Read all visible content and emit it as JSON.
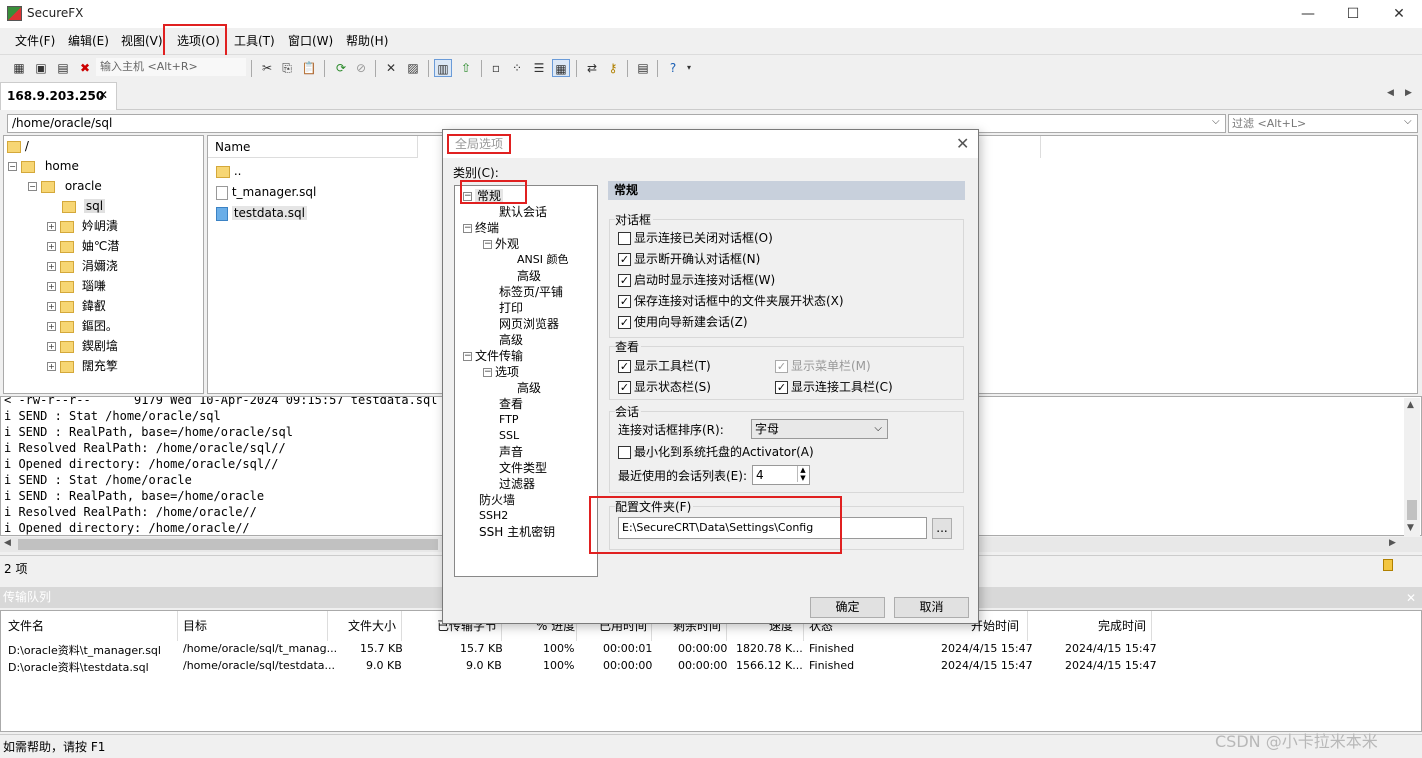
{
  "window": {
    "title": "SecureFX",
    "minimize": "—",
    "maximize": "☐",
    "close": "✕"
  },
  "menu": [
    "文件(F)",
    "编辑(E)",
    "视图(V)",
    "选项(O)",
    "工具(T)",
    "窗口(W)",
    "帮助(H)"
  ],
  "toolbar": {
    "host_placeholder": "输入主机 <Alt+R>"
  },
  "tab": {
    "label": "168.9.203.250",
    "close": "✕",
    "nav_left": "◀",
    "nav_right": "▶"
  },
  "path": {
    "value": "/home/oracle/sql",
    "filter_placeholder": "过滤 <Alt+L>"
  },
  "tree": [
    {
      "label": "/",
      "level": 0,
      "expander": ""
    },
    {
      "label": "home",
      "level": 1,
      "expander": "−"
    },
    {
      "label": "oracle",
      "level": 2,
      "expander": "−"
    },
    {
      "label": "sql",
      "level": 3,
      "expander": ""
    },
    {
      "label": "妗岄潰",
      "level": 3,
      "expander": "+"
    },
    {
      "label": "妯℃澘",
      "level": 3,
      "expander": "+"
    },
    {
      "label": "涓嬭浇",
      "level": 3,
      "expander": "+"
    },
    {
      "label": "瑙嗛",
      "level": 3,
      "expander": "+"
    },
    {
      "label": "鍏叡",
      "level": 3,
      "expander": "+"
    },
    {
      "label": "鏂囨。",
      "level": 3,
      "expander": "+"
    },
    {
      "label": "鍥剧墖",
      "level": 3,
      "expander": "+"
    },
    {
      "label": "闊充箰",
      "level": 3,
      "expander": "+"
    }
  ],
  "files": {
    "header": "Name",
    "items": [
      {
        "name": "..",
        "type": "folder"
      },
      {
        "name": "t_manager.sql",
        "type": "file"
      },
      {
        "name": "testdata.sql",
        "type": "file-selected"
      }
    ]
  },
  "log": [
    "< -rw-r--r--      9179 Wed 10-Apr-2024 09:15:57 testdata.sql",
    "i SEND : Stat /home/oracle/sql",
    "i SEND : RealPath, base=/home/oracle/sql",
    "i Resolved RealPath: /home/oracle/sql//",
    "i Opened directory: /home/oracle/sql//",
    "i SEND : Stat /home/oracle",
    "i SEND : RealPath, base=/home/oracle",
    "i Resolved RealPath: /home/oracle//",
    "i Opened directory: /home/oracle//"
  ],
  "status": {
    "items_count": "2 项",
    "help": "如需帮助，请按 F1"
  },
  "queue": {
    "title": "传输队列",
    "close": "✕",
    "columns": [
      "文件名",
      "目标",
      "文件大小",
      "已传输字节",
      "% 进度",
      "已用时间",
      "剩余时间",
      "速度",
      "状态",
      "开始时间",
      "完成时间"
    ],
    "rows": [
      [
        "D:\\oracle资料\\t_manager.sql",
        "/home/oracle/sql/t_manag...",
        "15.7 KB",
        "15.7 KB",
        "100%",
        "00:00:01",
        "00:00:00",
        "1820.78 K...",
        "Finished",
        "2024/4/15 15:47",
        "2024/4/15 15:47"
      ],
      [
        "D:\\oracle资料\\testdata.sql",
        "/home/oracle/sql/testdata...",
        "9.0 KB",
        "9.0 KB",
        "100%",
        "00:00:00",
        "00:00:00",
        "1566.12 K...",
        "Finished",
        "2024/4/15 15:47",
        "2024/4/15 15:47"
      ]
    ]
  },
  "dialog": {
    "title": "全局选项",
    "close": "✕",
    "category_label": "类别(C):",
    "categories": [
      {
        "label": "常规",
        "expander": "−",
        "small": false
      },
      {
        "label": "默认会话",
        "expander": "",
        "small": false
      },
      {
        "label": "终端",
        "expander": "−",
        "small": false
      },
      {
        "label": "外观",
        "expander": "−",
        "small": false
      },
      {
        "label": "ANSI 颜色",
        "expander": "",
        "small": true
      },
      {
        "label": "高级",
        "expander": "",
        "small": false
      },
      {
        "label": "标签页/平铺",
        "expander": "",
        "small": false
      },
      {
        "label": "打印",
        "expander": "",
        "small": false
      },
      {
        "label": "网页浏览器",
        "expander": "",
        "small": false
      },
      {
        "label": "高级",
        "expander": "",
        "small": false
      },
      {
        "label": "文件传输",
        "expander": "−",
        "small": false
      },
      {
        "label": "选项",
        "expander": "−",
        "small": false
      },
      {
        "label": "高级",
        "expander": "",
        "small": false
      },
      {
        "label": "查看",
        "expander": "",
        "small": false
      },
      {
        "label": "FTP",
        "expander": "",
        "small": true
      },
      {
        "label": "SSL",
        "expander": "",
        "small": true
      },
      {
        "label": "声音",
        "expander": "",
        "small": false
      },
      {
        "label": "文件类型",
        "expander": "",
        "small": false
      },
      {
        "label": "过滤器",
        "expander": "",
        "small": false
      },
      {
        "label": "防火墙",
        "expander": "",
        "small": false
      },
      {
        "label": "SSH2",
        "expander": "",
        "small": true
      },
      {
        "label": "SSH 主机密钥",
        "expander": "",
        "small": false
      }
    ],
    "section_title": "常规",
    "dialogs_group": {
      "label": "对话框",
      "items": [
        {
          "label": "显示连接已关闭对话框(O)",
          "checked": false
        },
        {
          "label": "显示断开确认对话框(N)",
          "checked": true
        },
        {
          "label": "启动时显示连接对话框(W)",
          "checked": true
        },
        {
          "label": "保存连接对话框中的文件夹展开状态(X)",
          "checked": true
        },
        {
          "label": "使用向导新建会话(Z)",
          "checked": true
        }
      ]
    },
    "view_group": {
      "label": "查看",
      "show_toolbar": "显示工具栏(T)",
      "show_menubar": "显示菜单栏(M)",
      "show_statusbar": "显示状态栏(S)",
      "show_connect_toolbar": "显示连接工具栏(C)"
    },
    "session_group": {
      "label": "会话",
      "sort_label": "连接对话框排序(R):",
      "sort_value": "字母",
      "minimize_label": "最小化到系统托盘的Activator(A)",
      "recent_label": "最近使用的会话列表(E):",
      "recent_value": "4"
    },
    "config_group": {
      "label": "配置文件夹(F)",
      "path": "E:\\SecureCRT\\Data\\Settings\\Config",
      "browse": "..."
    },
    "ok": "确定",
    "cancel": "取消"
  },
  "watermark": "CSDN @小卡拉米本米"
}
